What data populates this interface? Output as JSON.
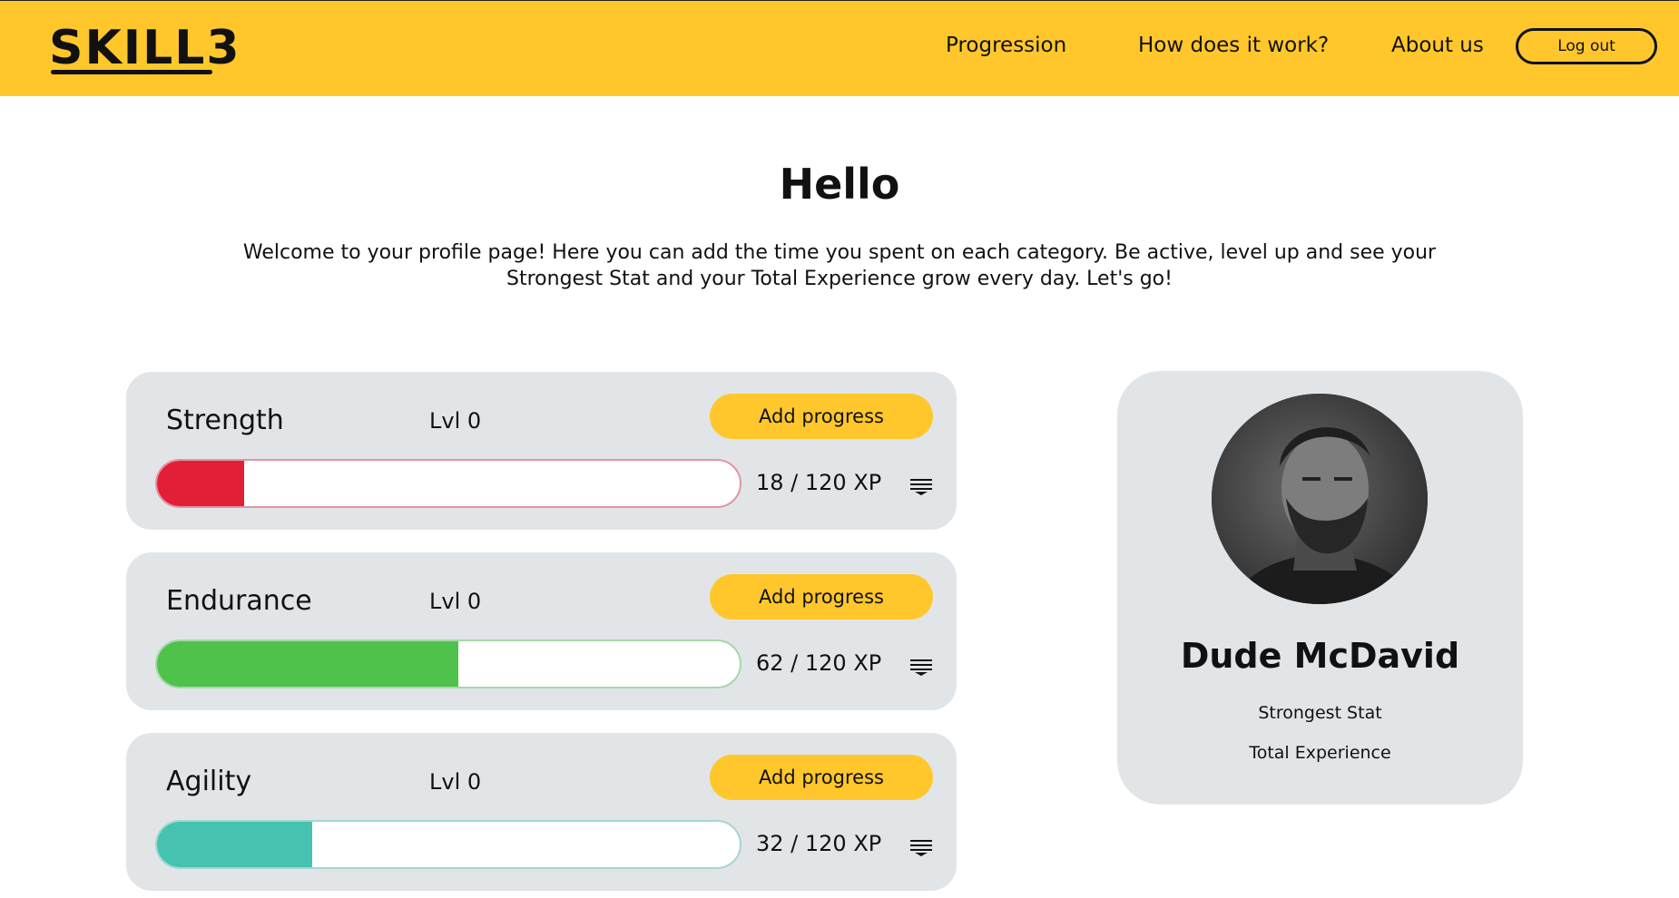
{
  "header": {
    "logo_text": "SKILL3",
    "nav": [
      {
        "label": "Progression"
      },
      {
        "label": "How does it work?"
      },
      {
        "label": "About us"
      }
    ],
    "logout_label": "Log out",
    "background_color": "#ffc72c"
  },
  "intro": {
    "title": "Hello",
    "text": "Welcome to your profile page! Here you can add the time you spent on each category. Be active, level up and see your Strongest Stat and your Total Experience grow every day. Let's go!"
  },
  "stats": [
    {
      "name": "Strength",
      "level": "Lvl 0",
      "button": "Add progress",
      "xp": 18,
      "xp_max": 120,
      "xp_text": "18 / 120 XP",
      "color": "#e21f36",
      "menu_icon": "menu-icon"
    },
    {
      "name": "Endurance",
      "level": "Lvl 0",
      "button": "Add progress",
      "xp": 62,
      "xp_max": 120,
      "xp_text": "62 / 120 XP",
      "color": "#4ec24a",
      "menu_icon": "menu-icon"
    },
    {
      "name": "Agility",
      "level": "Lvl 0",
      "button": "Add progress",
      "xp": 32,
      "xp_max": 120,
      "xp_text": "32 / 120 XP",
      "color": "#45c2b0",
      "menu_icon": "menu-icon"
    }
  ],
  "profile": {
    "name": "Dude McDavid",
    "strongest_stat_label": "Strongest Stat",
    "total_experience_label": "Total Experience",
    "avatar_icon": "avatar"
  }
}
